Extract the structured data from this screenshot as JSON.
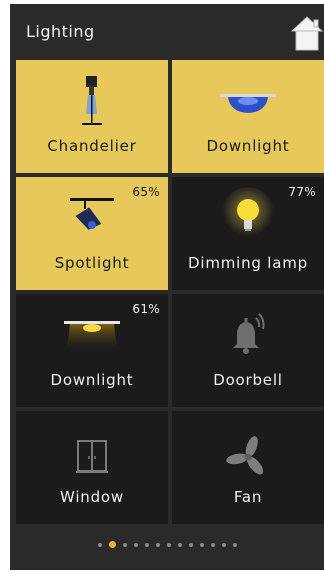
{
  "header": {
    "title": "Lighting",
    "home_icon": "home-icon"
  },
  "colors": {
    "panel_bg": "#2a2a2a",
    "tile_off": "#1b1b1b",
    "tile_on": "#e7c85a",
    "accent": "#e8b820"
  },
  "tiles": [
    {
      "label": "Chandelier",
      "icon": "chandelier-icon",
      "state": "on",
      "level": ""
    },
    {
      "label": "Downlight",
      "icon": "downlight-icon",
      "state": "on",
      "level": ""
    },
    {
      "label": "Spotlight",
      "icon": "spotlight-icon",
      "state": "on",
      "level": "65%"
    },
    {
      "label": "Dimming lamp",
      "icon": "bulb-icon",
      "state": "off",
      "level": "77%"
    },
    {
      "label": "Downlight",
      "icon": "downlight-glow-icon",
      "state": "off",
      "level": "61%"
    },
    {
      "label": "Doorbell",
      "icon": "bell-icon",
      "state": "off",
      "level": ""
    },
    {
      "label": "Window",
      "icon": "window-icon",
      "state": "off",
      "level": ""
    },
    {
      "label": "Fan",
      "icon": "fan-icon",
      "state": "off",
      "level": ""
    }
  ],
  "pagination": {
    "total_pages": 13,
    "current_page": 2
  }
}
